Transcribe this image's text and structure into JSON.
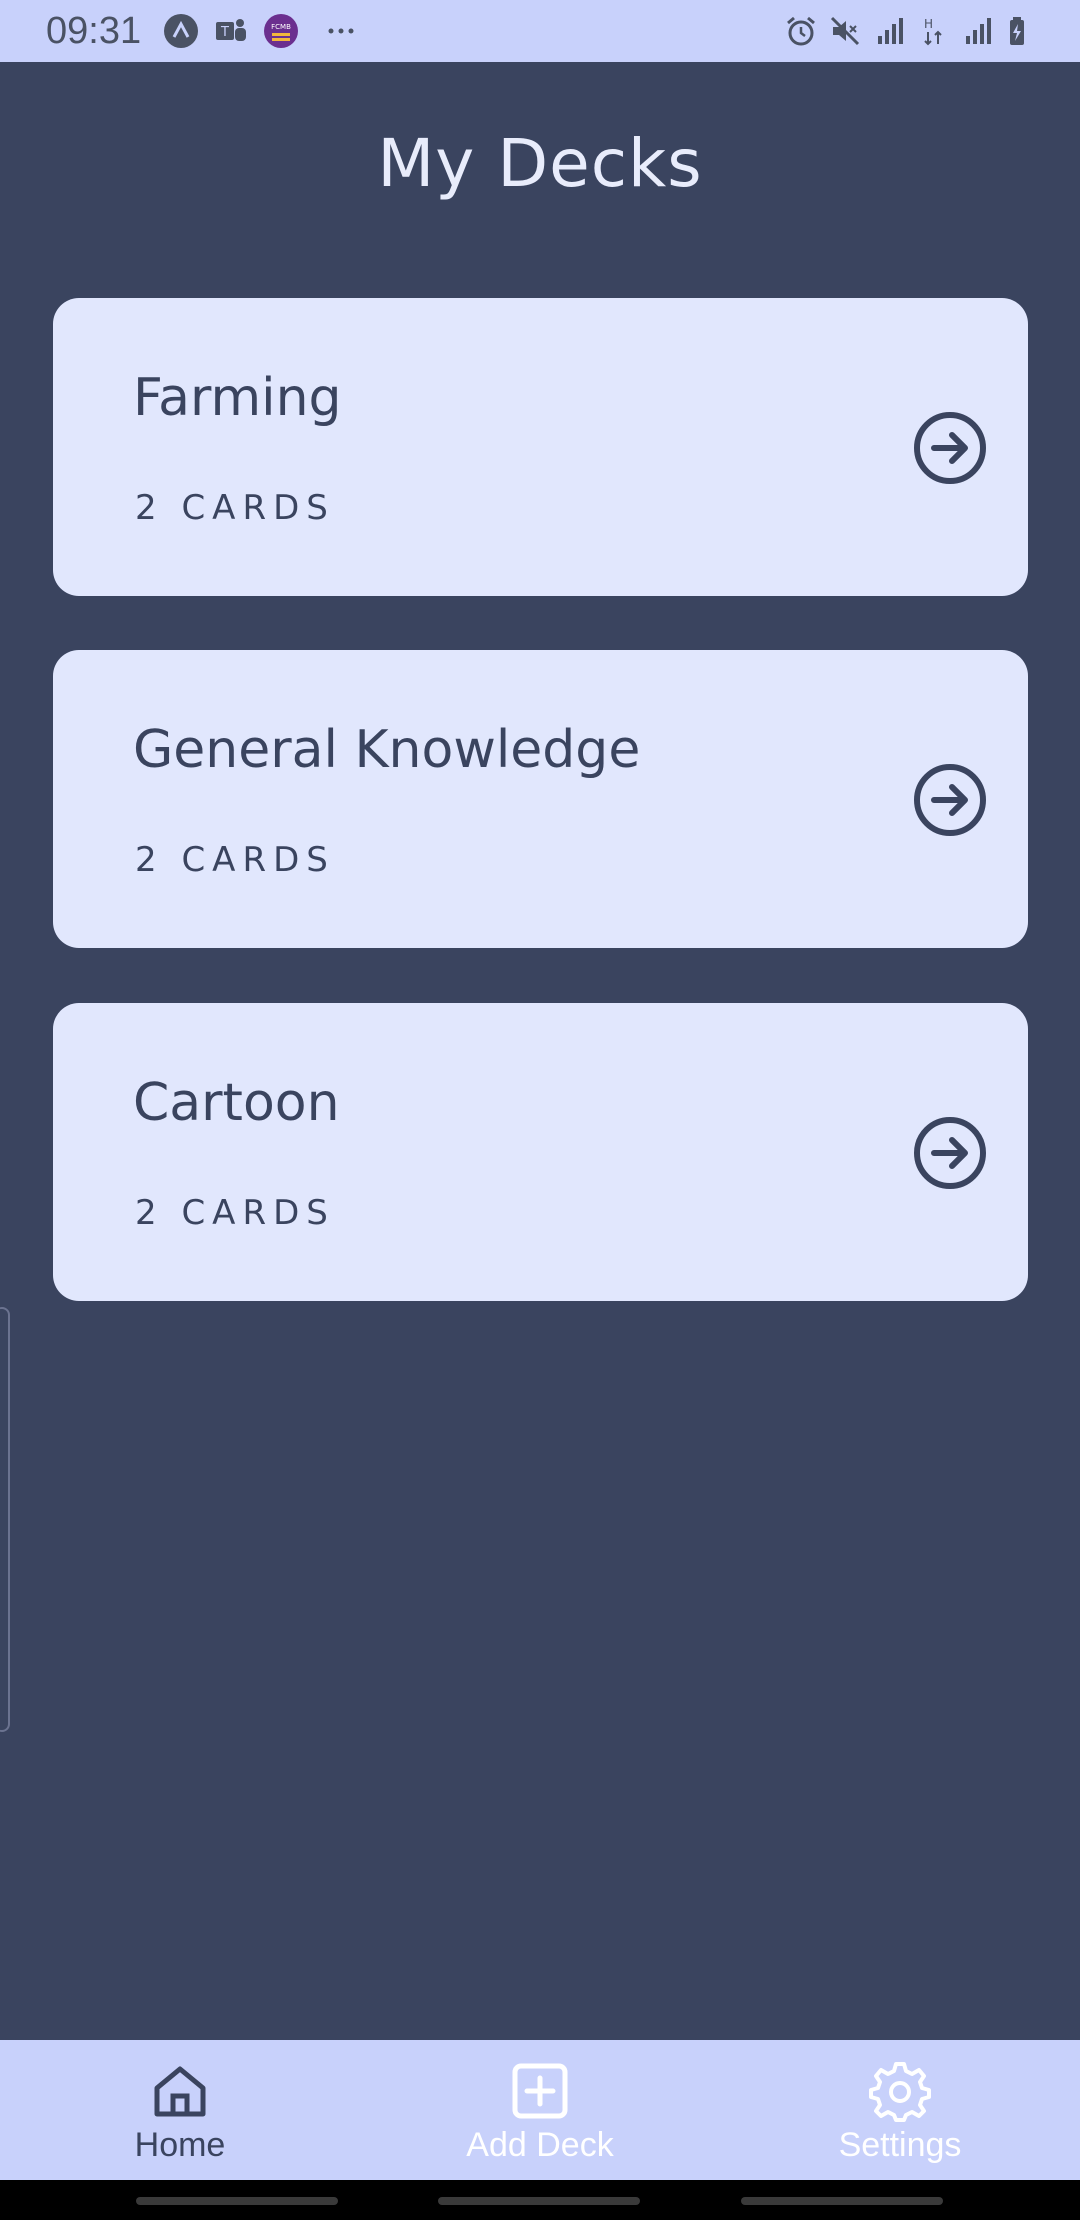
{
  "status_bar": {
    "time": "09:31",
    "notification_icons": [
      "arrow-app-icon",
      "teams-icon",
      "fcmb-icon",
      "more-dots-icon"
    ],
    "fcmb_label": "FCMB",
    "system_icons": [
      "alarm-icon",
      "mute-icon",
      "signal-icon",
      "data-arrows-icon",
      "signal-icon",
      "battery-charging-icon"
    ]
  },
  "page": {
    "title": "My Decks"
  },
  "decks": [
    {
      "name": "Farming",
      "count": "2 CARDS"
    },
    {
      "name": "General Knowledge",
      "count": "2 CARDS"
    },
    {
      "name": "Cartoon",
      "count": "2 CARDS"
    }
  ],
  "bottom_nav": {
    "items": [
      {
        "label": "Home",
        "icon": "home-icon",
        "active": true
      },
      {
        "label": "Add Deck",
        "icon": "add-box-icon",
        "active": false
      },
      {
        "label": "Settings",
        "icon": "gear-icon",
        "active": false
      }
    ]
  },
  "colors": {
    "background": "#3a445f",
    "card": "#e1e7fd",
    "bar": "#c8d1fb",
    "active_nav": "#3a445f",
    "inactive_nav": "#ffffff"
  }
}
